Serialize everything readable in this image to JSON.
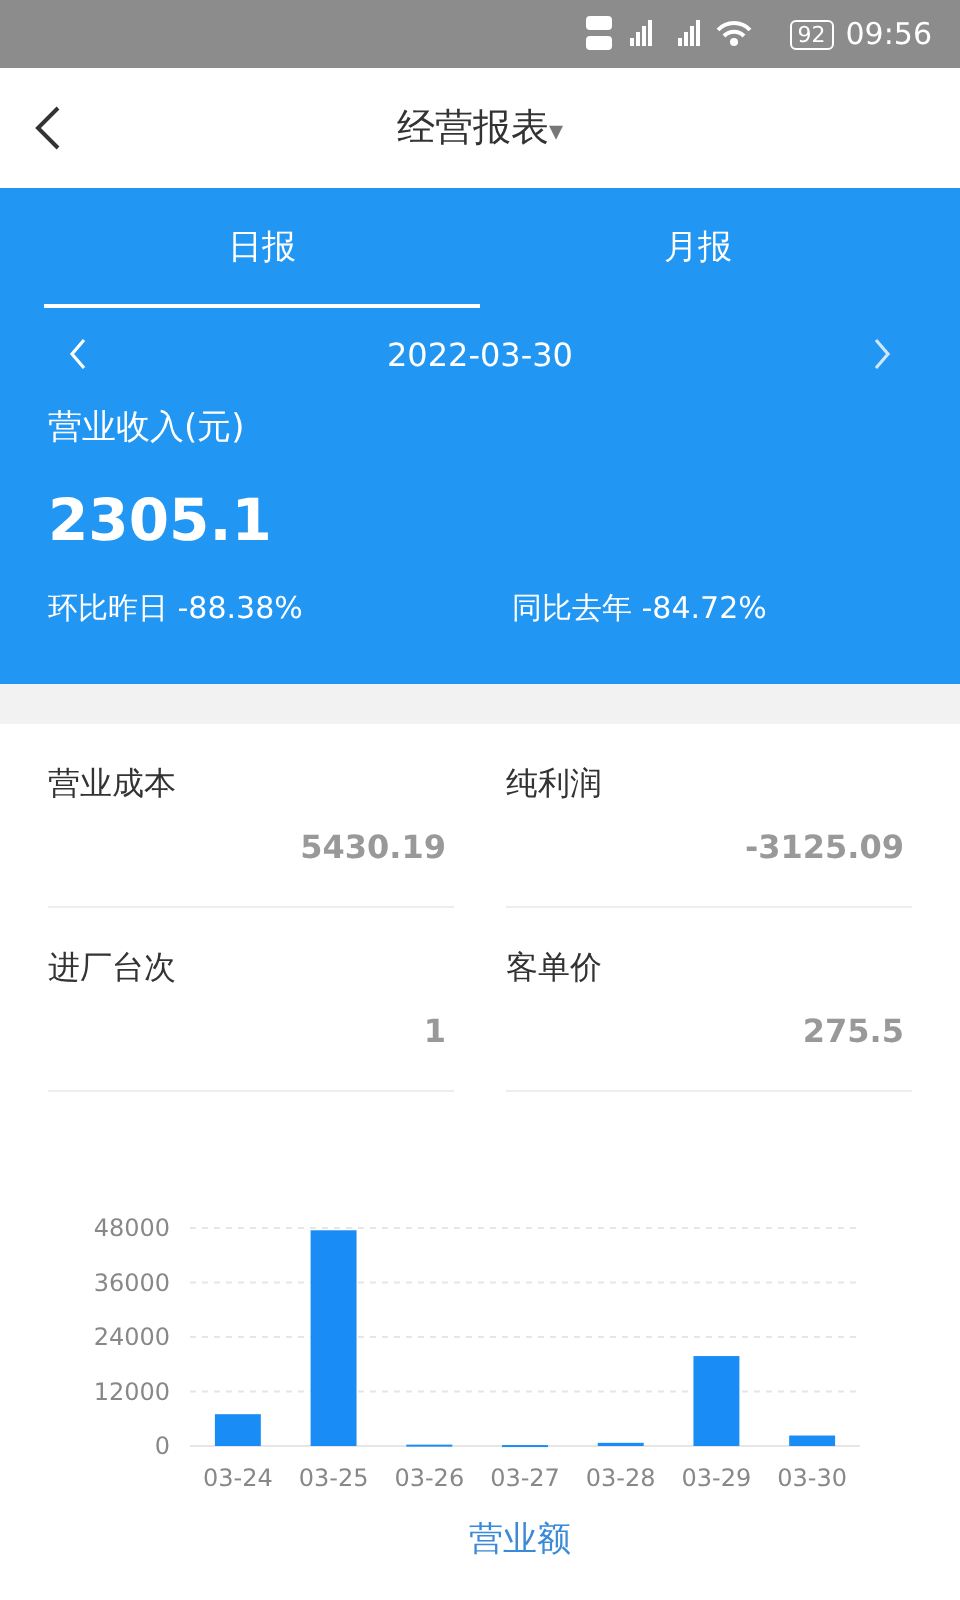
{
  "status_bar": {
    "battery": "92",
    "time": "09:56"
  },
  "header": {
    "title": "经营报表",
    "dropdown": "▾"
  },
  "tabs": [
    {
      "label": "日报",
      "selected": true
    },
    {
      "label": "月报",
      "selected": false
    }
  ],
  "date": "2022-03-30",
  "revenue": {
    "label": "营业收入(元)",
    "value": "2305.1",
    "compare": [
      "环比昨日 -88.38%",
      "同比去年 -84.72%"
    ]
  },
  "metrics": [
    {
      "label": "营业成本",
      "value": "5430.19"
    },
    {
      "label": "纯利润",
      "value": "-3125.09"
    },
    {
      "label": "进厂台次",
      "value": "1"
    },
    {
      "label": "客单价",
      "value": "275.5"
    }
  ],
  "chart": {
    "chart_data": {
      "type": "bar",
      "grid": true,
      "categories": [
        "03-24",
        "03-25",
        "03-26",
        "03-27",
        "03-28",
        "03-29",
        "03-30"
      ],
      "series": [
        {
          "name": "营业额",
          "color": "#1a8cf5",
          "values": [
            7000,
            47500,
            300,
            200,
            700,
            19800,
            2300
          ]
        }
      ],
      "ylim": [
        0,
        48000
      ],
      "yticks": [
        0,
        12000,
        24000,
        36000,
        48000
      ]
    }
  }
}
